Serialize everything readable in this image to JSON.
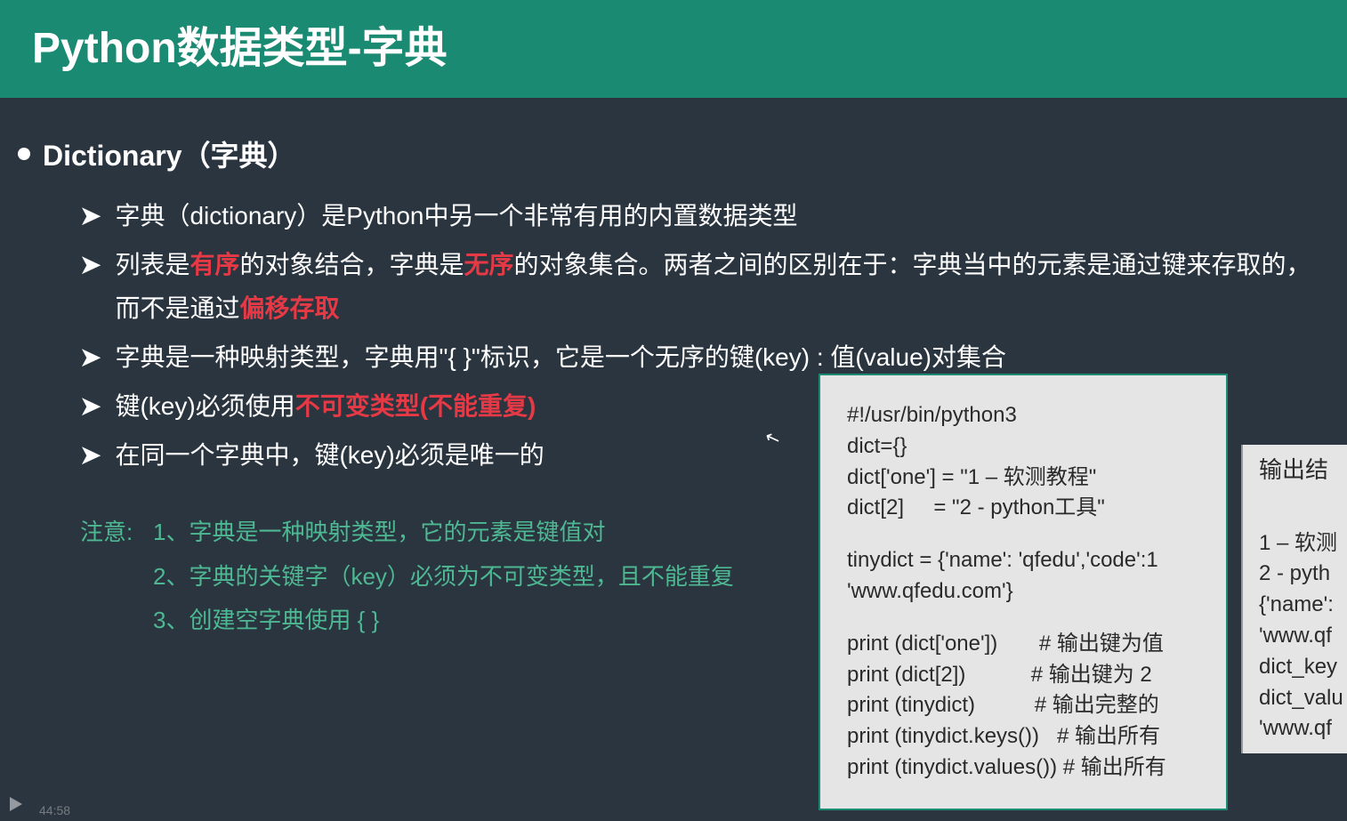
{
  "header": {
    "title": "Python数据类型-字典"
  },
  "section": {
    "title": "Dictionary（字典）"
  },
  "bullets": [
    {
      "pre": "字典（dictionary）是Python中另一个非常有用的内置数据类型",
      "red1": "",
      "mid": "",
      "red2": "",
      "post": ""
    },
    {
      "pre": "列表是",
      "red1": "有序",
      "mid": "的对象结合，字典是",
      "red2": "无序",
      "post": "的对象集合。两者之间的区别在于：字典当中的元素是通过键来存取的，而不是通过",
      "red3": "偏移存取"
    },
    {
      "pre": "字典是一种映射类型，字典用\"{ }\"标识，它是一个无序的键(key) : 值(value)对集合",
      "red1": "",
      "mid": "",
      "red2": "",
      "post": ""
    },
    {
      "pre": "键(key)必须使用",
      "red1": "不可变类型(不能重复)",
      "mid": "",
      "red2": "",
      "post": ""
    },
    {
      "pre": "在同一个字典中，键(key)必须是唯一的",
      "red1": "",
      "mid": "",
      "red2": "",
      "post": ""
    }
  ],
  "notes": {
    "label": "注意:",
    "items": [
      "1、字典是一种映射类型，它的元素是键值对",
      "2、字典的关键字（key）必须为不可变类型，且不能重复",
      "3、创建空字典使用 { }"
    ]
  },
  "code": {
    "lines": [
      "#!/usr/bin/python3",
      "dict={}",
      "dict['one'] = \"1 – 软测教程\"",
      "dict[2]     = \"2 - python工具\"",
      "",
      "tinydict = {'name': 'qfedu','code':1",
      "'www.qfedu.com'}",
      "",
      "print (dict['one'])       # 输出键为值",
      "print (dict[2])           # 输出键为 2",
      "print (tinydict)          # 输出完整的",
      "print (tinydict.keys())   # 输出所有",
      "print (tinydict.values()) # 输出所有"
    ]
  },
  "code2": {
    "title": "输出结",
    "lines": [
      "1 – 软测",
      "2 - pyth",
      "{'name':",
      "'www.qf",
      "dict_key",
      "dict_valu",
      "'www.qf"
    ]
  },
  "timestamp": "44:58"
}
